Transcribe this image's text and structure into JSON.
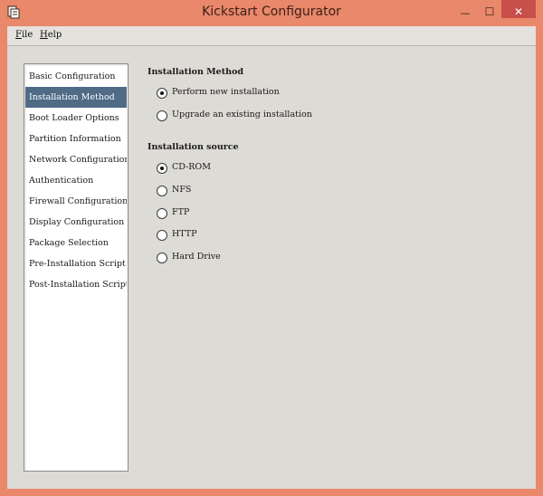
{
  "window": {
    "title": "Kickstart Configurator",
    "controls": {
      "minimize": "—",
      "maximize": "☐",
      "close": "✕"
    }
  },
  "menubar": {
    "items": [
      {
        "mnemonic": "F",
        "rest": "ile"
      },
      {
        "mnemonic": "H",
        "rest": "elp"
      }
    ]
  },
  "sidebar": {
    "selected": "Installation Method",
    "items": [
      {
        "label": "Basic Configuration"
      },
      {
        "label": "Installation Method"
      },
      {
        "label": "Boot Loader Options"
      },
      {
        "label": "Partition Information"
      },
      {
        "label": "Network Configuration"
      },
      {
        "label": "Authentication"
      },
      {
        "label": "Firewall Configuration"
      },
      {
        "label": "Display Configuration"
      },
      {
        "label": "Package Selection"
      },
      {
        "label": "Pre-Installation Script"
      },
      {
        "label": "Post-Installation Script"
      }
    ]
  },
  "installation_method": {
    "heading": "Installation Method",
    "options": [
      {
        "label": "Perform new installation",
        "selected": true
      },
      {
        "label": "Upgrade an existing installation",
        "selected": false
      }
    ]
  },
  "installation_source": {
    "heading": "Installation source",
    "options": [
      {
        "label": "CD-ROM",
        "selected": true
      },
      {
        "label": "NFS",
        "selected": false
      },
      {
        "label": "FTP",
        "selected": false
      },
      {
        "label": "HTTP",
        "selected": false
      },
      {
        "label": "Hard Drive",
        "selected": false
      }
    ]
  },
  "colors": {
    "window_frame": "#e9886a",
    "close_button": "#c7504a",
    "selection": "#4f6b86",
    "panel": "#dddbd5"
  }
}
